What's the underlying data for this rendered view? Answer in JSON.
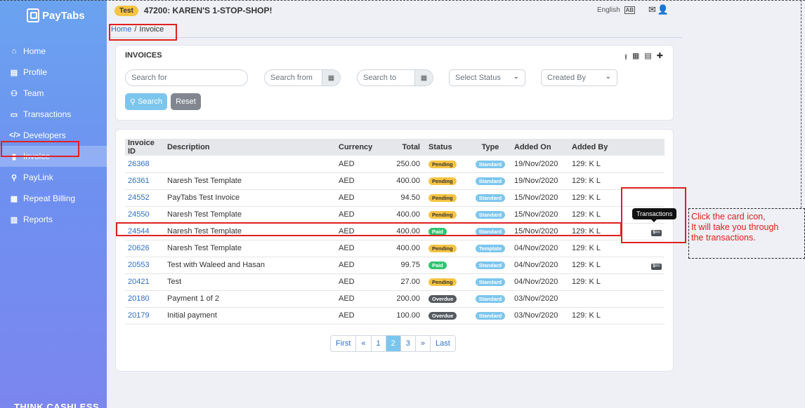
{
  "brand": {
    "name": "PayTabs",
    "footer": "THINK CASHLESS"
  },
  "sidebar": {
    "items": [
      {
        "label": "Home",
        "icon": "⌂"
      },
      {
        "label": "Profile",
        "icon": "▤"
      },
      {
        "label": "Team",
        "icon": "⚇"
      },
      {
        "label": "Transactions",
        "icon": "▭"
      },
      {
        "label": "Developers",
        "icon": "</>"
      },
      {
        "label": "Invoice",
        "icon": "▮"
      },
      {
        "label": "PayLink",
        "icon": "⚲"
      },
      {
        "label": "Repeat Billing",
        "icon": "▦"
      },
      {
        "label": "Reports",
        "icon": "▥"
      }
    ]
  },
  "header": {
    "badge": "Test",
    "store": "47200: KAREN'S 1-STOP-SHOP!",
    "language": "English",
    "lang_icon": "AB"
  },
  "breadcrumb": {
    "home": "Home",
    "sep": "/",
    "current": "Invoice"
  },
  "filters": {
    "title": "INVOICES",
    "search_placeholder": "Search for",
    "from_placeholder": "Search from",
    "to_placeholder": "Search to",
    "status_placeholder": "Select Status",
    "created_placeholder": "Created By",
    "search_label": "Search",
    "reset_label": "Reset"
  },
  "table": {
    "headers": [
      "Invoice ID",
      "Description",
      "Currency",
      "Total",
      "Status",
      "Type",
      "Added On",
      "Added By"
    ],
    "rows": [
      {
        "id": "26368",
        "desc": "",
        "cur": "AED",
        "total": "250.00",
        "status": "Pending",
        "type": "Standard",
        "added_on": "19/Nov/2020",
        "added_by": "129: K L",
        "card": false
      },
      {
        "id": "26361",
        "desc": "Naresh Test Template",
        "cur": "AED",
        "total": "400.00",
        "status": "Pending",
        "type": "Standard",
        "added_on": "19/Nov/2020",
        "added_by": "129: K L",
        "card": false
      },
      {
        "id": "24552",
        "desc": "PayTabs Test Invoice",
        "cur": "AED",
        "total": "94.50",
        "status": "Pending",
        "type": "Standard",
        "added_on": "15/Nov/2020",
        "added_by": "129: K L",
        "card": false
      },
      {
        "id": "24550",
        "desc": "Naresh Test Template",
        "cur": "AED",
        "total": "400.00",
        "status": "Pending",
        "type": "Standard",
        "added_on": "15/Nov/2020",
        "added_by": "129: K L",
        "card": false
      },
      {
        "id": "24544",
        "desc": "Naresh Test Template",
        "cur": "AED",
        "total": "400.00",
        "status": "Paid",
        "type": "Standard",
        "added_on": "15/Nov/2020",
        "added_by": "129: K L",
        "card": true
      },
      {
        "id": "20626",
        "desc": "Naresh Test Template",
        "cur": "AED",
        "total": "400.00",
        "status": "Pending",
        "type": "Template",
        "added_on": "04/Nov/2020",
        "added_by": "129: K L",
        "card": false
      },
      {
        "id": "20553",
        "desc": "Test with Waleed and Hasan",
        "cur": "AED",
        "total": "99.75",
        "status": "Paid",
        "type": "Standard",
        "added_on": "04/Nov/2020",
        "added_by": "129: K L",
        "card": true
      },
      {
        "id": "20421",
        "desc": "Test",
        "cur": "AED",
        "total": "27.00",
        "status": "Pending",
        "type": "Standard",
        "added_on": "04/Nov/2020",
        "added_by": "129: K L",
        "card": false
      },
      {
        "id": "20180",
        "desc": "Payment 1 of 2",
        "cur": "AED",
        "total": "200.00",
        "status": "Overdue",
        "type": "Standard",
        "added_on": "03/Nov/2020",
        "added_by": "",
        "card": false
      },
      {
        "id": "20179",
        "desc": "Initial payment",
        "cur": "AED",
        "total": "100.00",
        "status": "Overdue",
        "type": "Standard",
        "added_on": "03/Nov/2020",
        "added_by": "129: K L",
        "card": false
      }
    ]
  },
  "pagination": {
    "first": "First",
    "prev": "«",
    "pages": [
      "1",
      "2",
      "3"
    ],
    "active": "2",
    "next": "»",
    "last": "Last"
  },
  "tooltip": "Transactions",
  "card_icon_text": "$==",
  "annotation": {
    "line1": "Click the card icon,",
    "line2": "It will take you through",
    "line3": "the transactions."
  },
  "colors": {
    "accent": "#7cc6ee",
    "pending": "#f6c443",
    "paid": "#2ec46f",
    "overdue": "#555a60",
    "highlight": "#e02020",
    "link": "#2e6fc7"
  }
}
